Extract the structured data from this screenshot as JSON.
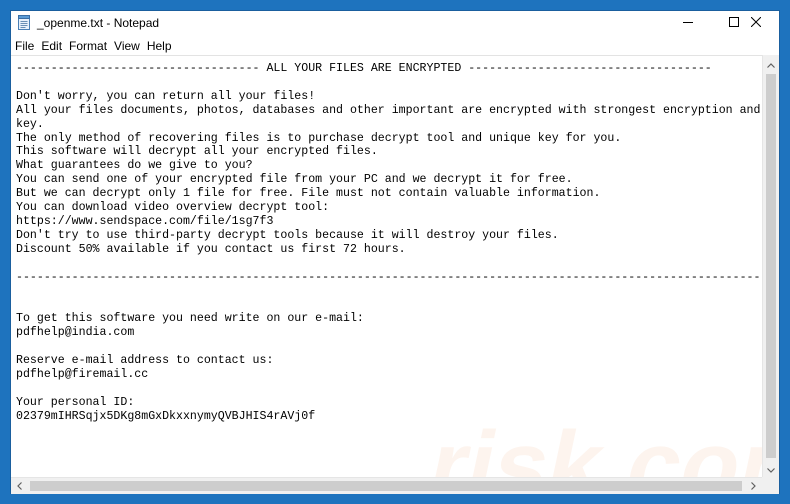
{
  "window": {
    "title": "_openme.txt - Notepad",
    "buttons": {
      "minimize": "—",
      "maximize": "☐",
      "close": "✕"
    }
  },
  "menu": {
    "items": [
      "File",
      "Edit",
      "Format",
      "View",
      "Help"
    ]
  },
  "document": {
    "lines": [
      "----------------------------------- ALL YOUR FILES ARE ENCRYPTED -----------------------------------",
      "",
      "Don't worry, you can return all your files!",
      "All your files documents, photos, databases and other important are encrypted with strongest encryption and unique",
      "key.",
      "The only method of recovering files is to purchase decrypt tool and unique key for you.",
      "This software will decrypt all your encrypted files.",
      "What guarantees do we give to you?",
      "You can send one of your encrypted file from your PC and we decrypt it for free.",
      "But we can decrypt only 1 file for free. File must not contain valuable information.",
      "You can download video overview decrypt tool:",
      "https://www.sendspace.com/file/1sg7f3",
      "Don't try to use third-party decrypt tools because it will destroy your files.",
      "Discount 50% available if you contact us first 72 hours.",
      "",
      "--------------------------------------------------------------------------------------------------------------------",
      "",
      "",
      "To get this software you need write on our e-mail:",
      "pdfhelp@india.com",
      "",
      "Reserve e-mail address to contact us:",
      "pdfhelp@firemail.cc",
      "",
      "Your personal ID:",
      "02379mIHRSqjx5DKg8mGxDkxxnymyQVBJHIS4rAVj0f"
    ]
  },
  "watermark": {
    "text": "risk.com"
  },
  "colors": {
    "desktop": "#1e73be",
    "window_bg": "#ffffff",
    "scrollbar": "#f0f0f0",
    "thumb": "#cdcdcd"
  }
}
